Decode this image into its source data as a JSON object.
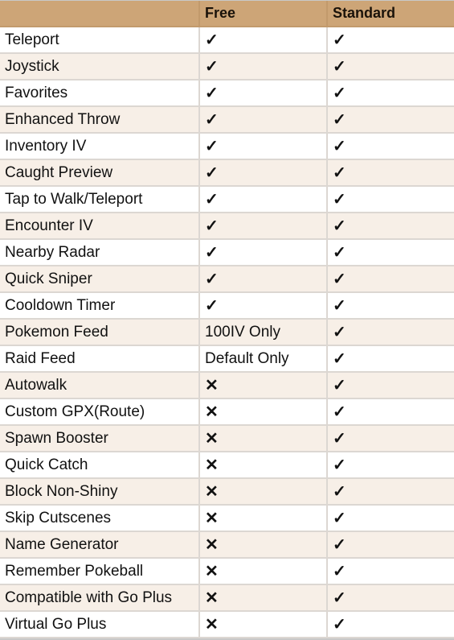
{
  "table": {
    "headers": [
      "",
      "Free",
      "Standard"
    ],
    "rows": [
      {
        "feature": "Teleport",
        "free": "✓",
        "standard": "✓"
      },
      {
        "feature": "Joystick",
        "free": "✓",
        "standard": "✓"
      },
      {
        "feature": "Favorites",
        "free": "✓",
        "standard": "✓"
      },
      {
        "feature": "Enhanced Throw",
        "free": "✓",
        "standard": "✓"
      },
      {
        "feature": "Inventory IV",
        "free": "✓",
        "standard": "✓"
      },
      {
        "feature": "Caught Preview",
        "free": "✓",
        "standard": "✓"
      },
      {
        "feature": "Tap to Walk/Teleport",
        "free": "✓",
        "standard": "✓"
      },
      {
        "feature": "Encounter IV",
        "free": "✓",
        "standard": "✓"
      },
      {
        "feature": "Nearby Radar",
        "free": "✓",
        "standard": "✓"
      },
      {
        "feature": "Quick Sniper",
        "free": "✓",
        "standard": "✓"
      },
      {
        "feature": "Cooldown Timer",
        "free": "✓",
        "standard": "✓"
      },
      {
        "feature": "Pokemon Feed",
        "free": "100IV Only",
        "standard": "✓"
      },
      {
        "feature": "Raid Feed",
        "free": "Default Only",
        "standard": "✓"
      },
      {
        "feature": "Autowalk",
        "free": "✕",
        "standard": "✓"
      },
      {
        "feature": "Custom GPX(Route)",
        "free": "✕",
        "standard": "✓"
      },
      {
        "feature": "Spawn Booster",
        "free": "✕",
        "standard": "✓"
      },
      {
        "feature": "Quick Catch",
        "free": "✕",
        "standard": "✓"
      },
      {
        "feature": "Block Non-Shiny",
        "free": "✕",
        "standard": "✓"
      },
      {
        "feature": "Skip Cutscenes",
        "free": "✕",
        "standard": "✓"
      },
      {
        "feature": "Name Generator",
        "free": "✕",
        "standard": "✓"
      },
      {
        "feature": "Remember Pokeball",
        "free": "✕",
        "standard": "✓"
      },
      {
        "feature": "Compatible with Go Plus",
        "free": "✕",
        "standard": "✓"
      },
      {
        "feature": "Virtual Go Plus",
        "free": "✕",
        "standard": "✓"
      }
    ]
  }
}
